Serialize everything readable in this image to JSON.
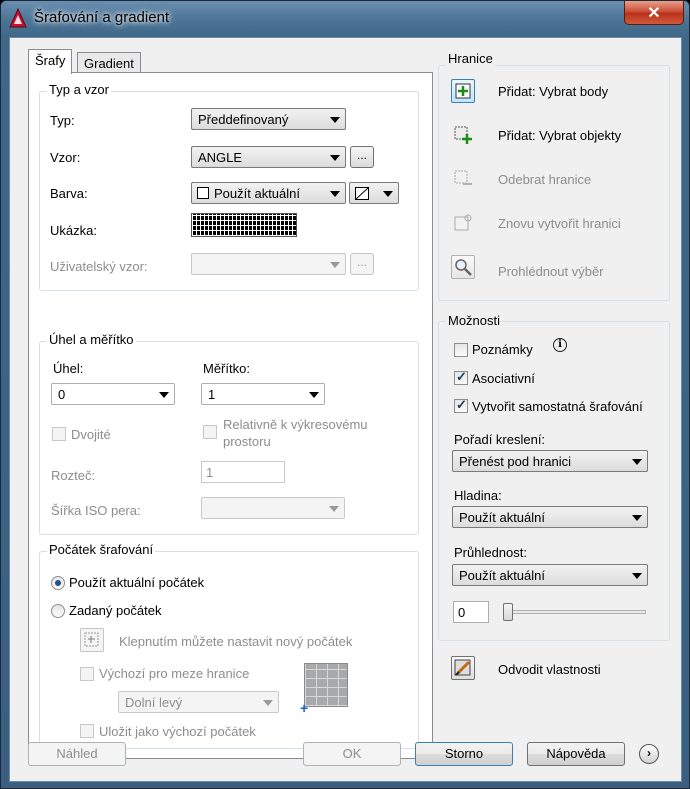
{
  "window": {
    "title": "Šrafování a gradient",
    "close_label": "✕"
  },
  "tabs": [
    {
      "label": "Šrafy"
    },
    {
      "label": "Gradient"
    }
  ],
  "type_pattern": {
    "title": "Typ a vzor",
    "type_label": "Typ:",
    "type_value": "Předdefinovaný",
    "pattern_label": "Vzor:",
    "pattern_value": "ANGLE",
    "pattern_browse": "...",
    "color_label": "Barva:",
    "color_value": "Použít aktuální",
    "preview_label": "Ukázka:",
    "custom_label": "Uživatelský vzor:",
    "custom_browse": "..."
  },
  "angle_scale": {
    "title": "Úhel a měřítko",
    "angle_label": "Úhel:",
    "angle_value": "0",
    "scale_label": "Měřítko:",
    "scale_value": "1",
    "double_label": "Dvojité",
    "relative_label_1": "Relativně k výkresovému",
    "relative_label_2": "prostoru",
    "spacing_label": "Rozteč:",
    "spacing_value": "1",
    "iso_label": "Šířka ISO pera:"
  },
  "origin": {
    "title": "Počátek šrafování",
    "current_label": "Použít aktuální počátek",
    "specified_label": "Zadaný počátek",
    "click_label": "Klepnutím můžete nastavit nový počátek",
    "default_extents_label": "Výchozí pro meze hranice",
    "position_value": "Dolní levý",
    "store_label": "Uložit jako výchozí počátek"
  },
  "boundaries": {
    "title": "Hranice",
    "pick_points": "Přidat: Vybrat body",
    "select_objects": "Přidat: Vybrat objekty",
    "remove": "Odebrat hranice",
    "recreate": "Znovu vytvořit hranici",
    "view": "Prohlédnout výběr"
  },
  "options": {
    "title": "Možnosti",
    "annotative": "Poznámky",
    "associative": "Asociativní",
    "separate": "Vytvořit samostatná šrafování",
    "draw_order_label": "Pořadí kreslení:",
    "draw_order_value": "Přenést pod hranici",
    "layer_label": "Hladina:",
    "layer_value": "Použít aktuální",
    "transparency_label": "Průhlednost:",
    "transparency_value": "Použít aktuální",
    "transparency_number": "0",
    "transparency_level": 0
  },
  "inherit": "Odvodit vlastnosti",
  "buttons": {
    "preview": "Náhled",
    "ok": "OK",
    "cancel": "Storno",
    "help": "Nápověda",
    "expand": "›"
  }
}
